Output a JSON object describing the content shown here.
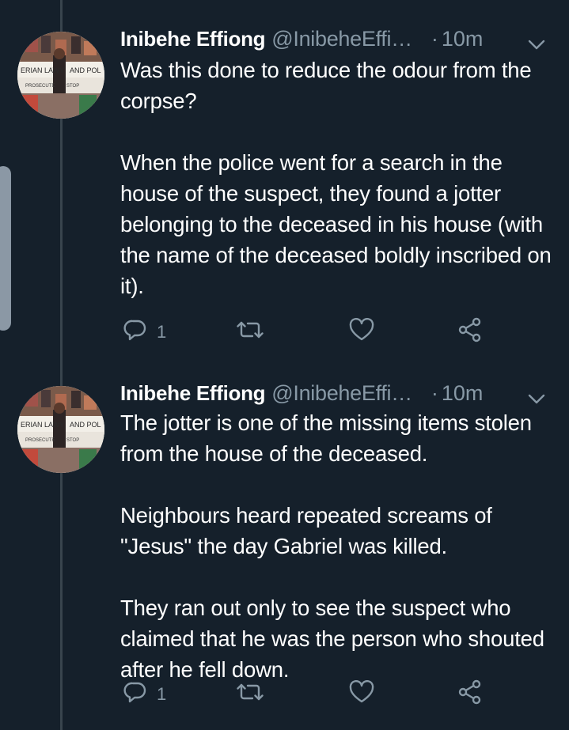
{
  "tweets": [
    {
      "name": "Inibehe Effiong",
      "handle": "@InibeheEffi…",
      "separator": "·",
      "time": "10m",
      "text": "Was this done to reduce the odour from the corpse?\n\nWhen the police went for a search in the house of the suspect, they found a jotter belonging to the deceased in his house (with the name of the deceased boldly inscribed on it).",
      "reply_count": "1",
      "icons": [
        "reply-icon",
        "retweet-icon",
        "like-icon",
        "share-icon"
      ]
    },
    {
      "name": "Inibehe Effiong",
      "handle": "@InibeheEffi…",
      "separator": "·",
      "time": "10m",
      "text": "The jotter is one of the missing items stolen from the house of the deceased.\n\nNeighbours heard repeated screams of \"Jesus\" the day Gabriel was killed.\n\nThey ran out only to see the suspect who claimed that he was the person who shouted after he fell down.",
      "reply_count": "1",
      "icons": [
        "reply-icon",
        "retweet-icon",
        "like-icon",
        "share-icon"
      ]
    }
  ],
  "colors": {
    "background": "#15202b",
    "text": "#ffffff",
    "secondary": "#8899a6",
    "thread_line": "#38444d"
  }
}
